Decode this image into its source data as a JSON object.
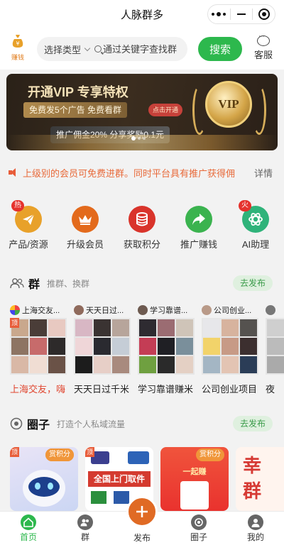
{
  "app": {
    "title": "人脉群多"
  },
  "search": {
    "earn_label": "赚钱",
    "type_label": "选择类型",
    "placeholder": "通过关键字查找群",
    "button_label": "搜索",
    "service_label": "客服"
  },
  "banner": {
    "title": "开通VIP 专享特权",
    "pill1": "免费发5个广告 免费看群",
    "open_label": "点击开通",
    "pill2": "推广佣金20%  分享奖励0.1元",
    "badge": "VIP"
  },
  "notice": {
    "text": "上级别的会员可免费进群。同时平台具有推广获得佣",
    "more_label": "详情"
  },
  "shortcuts": [
    {
      "label": "产品/资源",
      "badge": "热",
      "color": "#e8a12a"
    },
    {
      "label": "升级会员",
      "badge": "",
      "color": "#e36a1c"
    },
    {
      "label": "获取积分",
      "badge": "",
      "color": "#d9342b"
    },
    {
      "label": "推广赚钱",
      "badge": "",
      "color": "#3bb34f"
    },
    {
      "label": "AI助理",
      "badge": "火",
      "color": "#2fb37a"
    }
  ],
  "group_section": {
    "title": "群",
    "subtitle": "推群、换群",
    "publish_label": "去发布"
  },
  "groups": [
    {
      "name": "上海交友...",
      "caption": "上海交友，嗨",
      "pinned": true,
      "pinned_label": "顶"
    },
    {
      "name": "天天日过...",
      "caption": "天天日过千米",
      "pinned": false,
      "pinned_label": ""
    },
    {
      "name": "学习靠谱...",
      "caption": "学习靠谱赚米",
      "pinned": false,
      "pinned_label": ""
    },
    {
      "name": "公司创业...",
      "caption": "公司创业项目",
      "pinned": false,
      "pinned_label": ""
    },
    {
      "name": "",
      "caption": "夜",
      "pinned": false,
      "pinned_label": ""
    }
  ],
  "circle_section": {
    "title": "圈子",
    "subtitle": "打造个人私域流量",
    "publish_label": "去发布"
  },
  "circles": [
    {
      "pinned_label": "顶",
      "reward_label": "赏积分",
      "caption": ""
    },
    {
      "pinned_label": "顶",
      "reward_label": "",
      "caption": "全国上门取件"
    },
    {
      "pinned_label": "",
      "reward_label": "赏积分",
      "caption": "一起赚"
    },
    {
      "pinned_label": "",
      "reward_label": "",
      "caption": "幸 群"
    }
  ],
  "tabbar": [
    {
      "label": "首页",
      "icon": "home-icon",
      "active": true
    },
    {
      "label": "群",
      "icon": "group-icon",
      "active": false
    },
    {
      "label": "发布",
      "icon": "plus-icon",
      "active": false
    },
    {
      "label": "圈子",
      "icon": "circle-icon",
      "active": false
    },
    {
      "label": "我的",
      "icon": "profile-icon",
      "active": false
    }
  ],
  "colors": {
    "brand_green": "#2db84d",
    "notice_orange": "#e86a3a",
    "publish_orange": "#e06a24"
  }
}
